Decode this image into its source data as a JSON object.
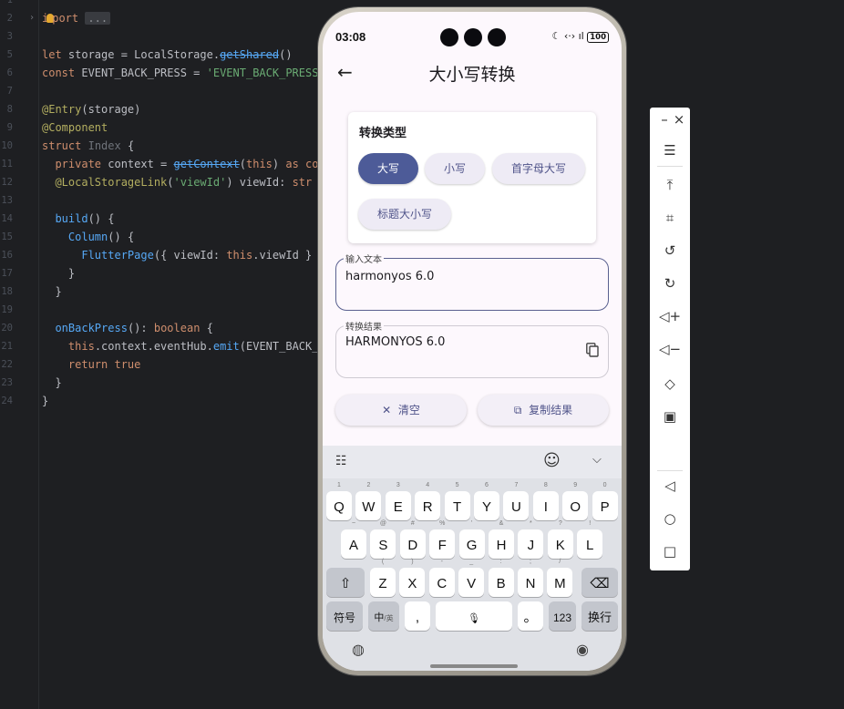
{
  "editor": {
    "lines": [
      {
        "n": "2",
        "code": "import ..."
      },
      {
        "n": "3",
        "code": ""
      },
      {
        "n": "5",
        "code": "let storage = LocalStorage.getShared()"
      },
      {
        "n": "6",
        "code": "const EVENT_BACK_PRESS = 'EVENT_BACK_PRESS"
      },
      {
        "n": "7",
        "code": ""
      },
      {
        "n": "8",
        "code": "@Entry(storage)"
      },
      {
        "n": "9",
        "code": "@Component"
      },
      {
        "n": "10",
        "code": "struct Index {"
      },
      {
        "n": "11",
        "code": "  private context = getContext(this) as co"
      },
      {
        "n": "12",
        "code": "  @LocalStorageLink('viewId') viewId: str"
      },
      {
        "n": "13",
        "code": ""
      },
      {
        "n": "14",
        "code": "  build() {"
      },
      {
        "n": "15",
        "code": "    Column() {"
      },
      {
        "n": "16",
        "code": "      FlutterPage({ viewId: this.viewId }"
      },
      {
        "n": "17",
        "code": "    }"
      },
      {
        "n": "18",
        "code": "  }"
      },
      {
        "n": "19",
        "code": ""
      },
      {
        "n": "20",
        "code": "  onBackPress(): boolean {"
      },
      {
        "n": "21",
        "code": "    this.context.eventHub.emit(EVENT_BACK_"
      },
      {
        "n": "22",
        "code": "    return true"
      },
      {
        "n": "23",
        "code": "  }"
      },
      {
        "n": "24",
        "code": "}"
      }
    ],
    "top_line_number": "1"
  },
  "phone": {
    "status": {
      "time": "03:08",
      "battery": "100"
    },
    "page_title": "大小写转换",
    "card": {
      "title": "转换类型",
      "chips": [
        "大写",
        "小写",
        "首字母大写",
        "标题大小写"
      ],
      "selected": "大写"
    },
    "input": {
      "label": "输入文本",
      "value": "harmonyos 6.0"
    },
    "result": {
      "label": "转换结果",
      "value": "HARMONYOS 6.0"
    },
    "buttons": {
      "clear": "清空",
      "copy": "复制结果"
    },
    "keyboard": {
      "row1": [
        "Q",
        "W",
        "E",
        "R",
        "T",
        "Y",
        "U",
        "I",
        "O",
        "P"
      ],
      "row1_sup": [
        "1",
        "2",
        "3",
        "4",
        "5",
        "6",
        "7",
        "8",
        "9",
        "0"
      ],
      "row2": [
        "A",
        "S",
        "D",
        "F",
        "G",
        "H",
        "J",
        "K",
        "L"
      ],
      "row2_sup": [
        "~",
        "@",
        "#",
        "%",
        "'",
        "&",
        "*",
        "?",
        "!"
      ],
      "row3": [
        "Z",
        "X",
        "C",
        "V",
        "B",
        "N",
        "M"
      ],
      "row3_sup": [
        "(",
        ")",
        "-",
        "_",
        ":",
        ";",
        "/"
      ],
      "symbols": "符号",
      "lang": "中",
      "lang_sub": "/英",
      "comma": ",",
      "period": "。",
      "num": "123",
      "enter": "换行"
    }
  },
  "colors": {
    "accent": "#4d5b98",
    "chip_bg": "#eeebf5",
    "screen_bg": "#fdf8fd",
    "editor_bg": "#1e1f22"
  }
}
